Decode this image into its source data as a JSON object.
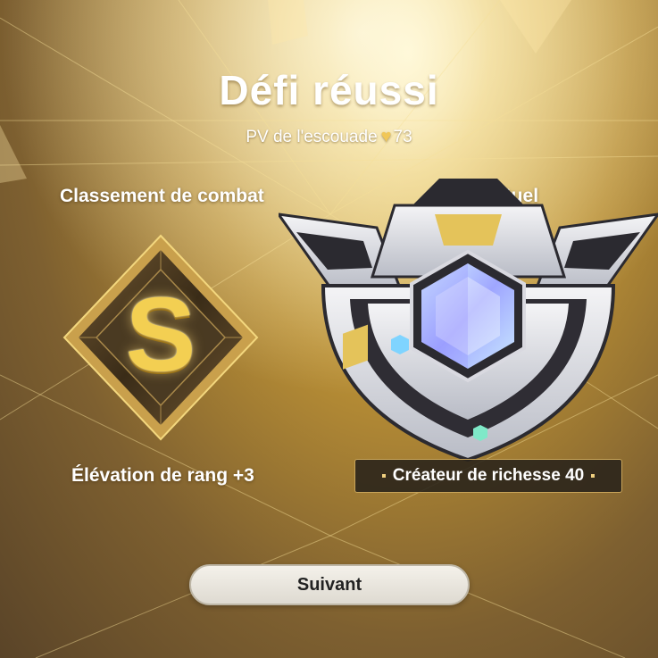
{
  "result": {
    "title": "Défi réussi",
    "squad_hp_label": "PV de l'escouade",
    "squad_hp_icon": "heart-icon",
    "squad_hp_value": "73"
  },
  "combat_rating": {
    "label": "Classement de combat",
    "grade": "S",
    "elevation_text": "Élévation de rang",
    "elevation_value": "+3"
  },
  "current_rank": {
    "label": "Rang actuel",
    "name": "Créateur de richesse 40"
  },
  "actions": {
    "next_label": "Suivant"
  },
  "colors": {
    "gold": "#f1c757",
    "rank_plate": "#28221a",
    "button": "#f4f1ea"
  }
}
